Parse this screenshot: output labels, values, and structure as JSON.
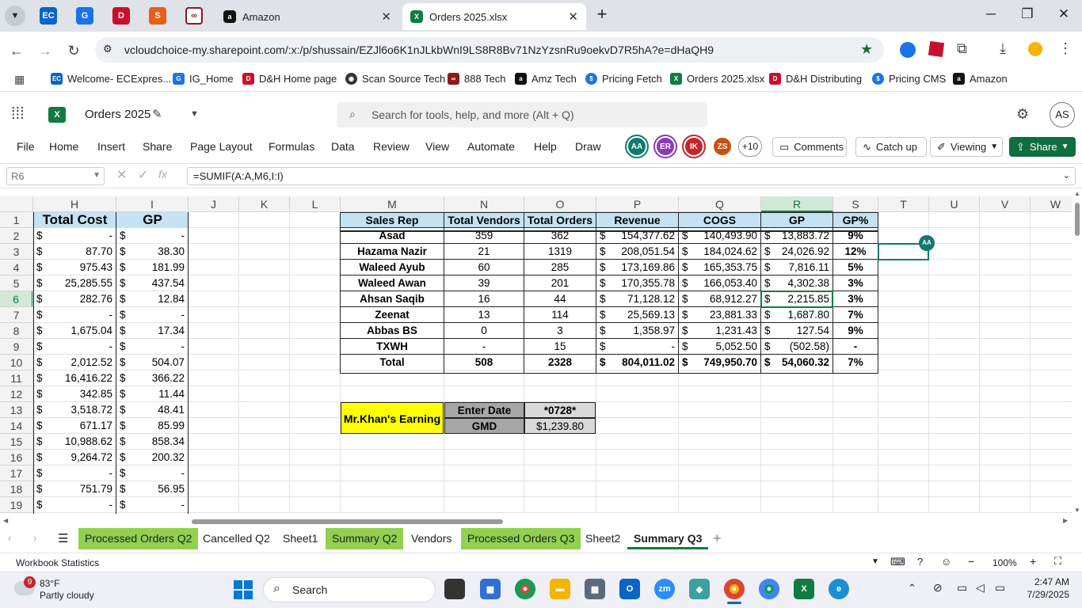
{
  "browser": {
    "tabs": [
      {
        "label": "Amazon"
      },
      {
        "label": "Orders 2025.xlsx"
      }
    ],
    "url": "vcloudchoice-my.sharepoint.com/:x:/p/shussain/EZJl6o6K1nJLkbWnI9LS8R8Bv71NzYzsnRu9oekvD7R5hA?e=dHaQH9",
    "bookmarks": [
      "Welcome- ECExpres...",
      "IG_Home",
      "D&H Home page",
      "Scan Source Tech",
      "888 Tech",
      "Amz Tech",
      "Pricing Fetch",
      "Orders 2025.xlsx",
      "D&H Distributing",
      "Pricing CMS",
      "Amazon"
    ]
  },
  "excel": {
    "doc_title": "Orders 2025",
    "search_placeholder": "Search for tools, help, and more (Alt + Q)",
    "user_initials": "AS",
    "ribbon_tabs": [
      "File",
      "Home",
      "Insert",
      "Share",
      "Page Layout",
      "Formulas",
      "Data",
      "Review",
      "View",
      "Automate",
      "Help",
      "Draw"
    ],
    "collaborators": [
      {
        "initials": "AA",
        "color": "#0f7b6c"
      },
      {
        "initials": "ER",
        "color": "#8a3ab9"
      },
      {
        "initials": "IK",
        "color": "#c4262e"
      },
      {
        "initials": "ZS",
        "color": "#ca5010"
      }
    ],
    "more_collaborators": "+10",
    "buttons": {
      "comments": "Comments",
      "catchup": "Catch up",
      "viewing": "Viewing",
      "share": "Share"
    },
    "name_box": "R6",
    "formula": "=SUMIF(A:A,M6,I:I)",
    "cursor_badge": "AA"
  },
  "grid": {
    "columns": [
      "H",
      "I",
      "J",
      "K",
      "L",
      "M",
      "N",
      "O",
      "P",
      "Q",
      "R",
      "S",
      "T",
      "U",
      "V",
      "W"
    ],
    "rows": [
      "1",
      "2",
      "3",
      "4",
      "5",
      "6",
      "7",
      "8",
      "9",
      "10",
      "11",
      "12",
      "13",
      "14",
      "15",
      "16",
      "17",
      "18",
      "19"
    ],
    "left_headers": {
      "total_cost": "Total Cost",
      "gp": "GP"
    },
    "left_rows": [
      {
        "cost": "-",
        "gp": "-"
      },
      {
        "cost": "87.70",
        "gp": "38.30"
      },
      {
        "cost": "975.43",
        "gp": "181.99"
      },
      {
        "cost": "25,285.55",
        "gp": "437.54"
      },
      {
        "cost": "282.76",
        "gp": "12.84"
      },
      {
        "cost": "-",
        "gp": "-"
      },
      {
        "cost": "1,675.04",
        "gp": "17.34"
      },
      {
        "cost": "-",
        "gp": "-"
      },
      {
        "cost": "2,012.52",
        "gp": "504.07"
      },
      {
        "cost": "16,416.22",
        "gp": "366.22"
      },
      {
        "cost": "342.85",
        "gp": "11.44"
      },
      {
        "cost": "3,518.72",
        "gp": "48.41"
      },
      {
        "cost": "671.17",
        "gp": "85.99"
      },
      {
        "cost": "10,988.62",
        "gp": "858.34"
      },
      {
        "cost": "9,264.72",
        "gp": "200.32"
      },
      {
        "cost": "-",
        "gp": "-"
      },
      {
        "cost": "751.79",
        "gp": "56.95"
      },
      {
        "cost": "-",
        "gp": "-"
      }
    ],
    "currency": "$",
    "summary_headers": [
      "Sales Rep",
      "Total Vendors",
      "Total Orders",
      "Revenue",
      "COGS",
      "GP",
      "GP%"
    ],
    "summary_rows": [
      {
        "rep": "Asad",
        "vendors": "359",
        "orders": "362",
        "revenue": "154,377.62",
        "cogs": "140,493.90",
        "gp": "13,883.72",
        "gpp": "9%"
      },
      {
        "rep": "Hazama Nazir",
        "vendors": "21",
        "orders": "1319",
        "revenue": "208,051.54",
        "cogs": "184,024.62",
        "gp": "24,026.92",
        "gpp": "12%"
      },
      {
        "rep": "Waleed Ayub",
        "vendors": "60",
        "orders": "285",
        "revenue": "173,169.86",
        "cogs": "165,353.75",
        "gp": "7,816.11",
        "gpp": "5%"
      },
      {
        "rep": "Waleed Awan",
        "vendors": "39",
        "orders": "201",
        "revenue": "170,355.78",
        "cogs": "166,053.40",
        "gp": "4,302.38",
        "gpp": "3%"
      },
      {
        "rep": "Ahsan Saqib",
        "vendors": "16",
        "orders": "44",
        "revenue": "71,128.12",
        "cogs": "68,912.27",
        "gp": "2,215.85",
        "gpp": "3%"
      },
      {
        "rep": "Zeenat",
        "vendors": "13",
        "orders": "114",
        "revenue": "25,569.13",
        "cogs": "23,881.33",
        "gp": "1,687.80",
        "gpp": "7%"
      },
      {
        "rep": "Abbas BS",
        "vendors": "0",
        "orders": "3",
        "revenue": "1,358.97",
        "cogs": "1,231.43",
        "gp": "127.54",
        "gpp": "9%"
      },
      {
        "rep": "TXWH",
        "vendors": "-",
        "orders": "15",
        "revenue": "-",
        "cogs": "5,052.50",
        "gp": "(502.58)",
        "gpp": "-"
      },
      {
        "rep": "Total",
        "vendors": "508",
        "orders": "2328",
        "revenue": "804,011.02",
        "cogs": "749,950.70",
        "gp": "54,060.32",
        "gpp": "7%"
      }
    ],
    "earning": {
      "label": "Mr.Khan's Earning",
      "enter_date_label": "Enter Date",
      "enter_date_value": "*0728*",
      "gmd_label": "GMD",
      "gmd_value": "$1,239.80"
    }
  },
  "sheet_tabs": [
    {
      "label": "Processed Orders Q2",
      "green": true
    },
    {
      "label": "Cancelled Q2",
      "green": false
    },
    {
      "label": "Sheet1",
      "green": false
    },
    {
      "label": "Summary Q2",
      "green": true
    },
    {
      "label": "Vendors",
      "green": false
    },
    {
      "label": "Processed Orders Q3",
      "green": true
    },
    {
      "label": "Sheet2",
      "green": false
    },
    {
      "label": "Summary Q3",
      "green": false,
      "active": true
    }
  ],
  "status": {
    "left": "Workbook Statistics",
    "zoom": "100%"
  },
  "taskbar": {
    "weather_temp": "83°F",
    "weather_desc": "Partly cloudy",
    "weather_badge": "9",
    "search": "Search",
    "time": "2:47 AM",
    "date": "7/29/2025"
  }
}
